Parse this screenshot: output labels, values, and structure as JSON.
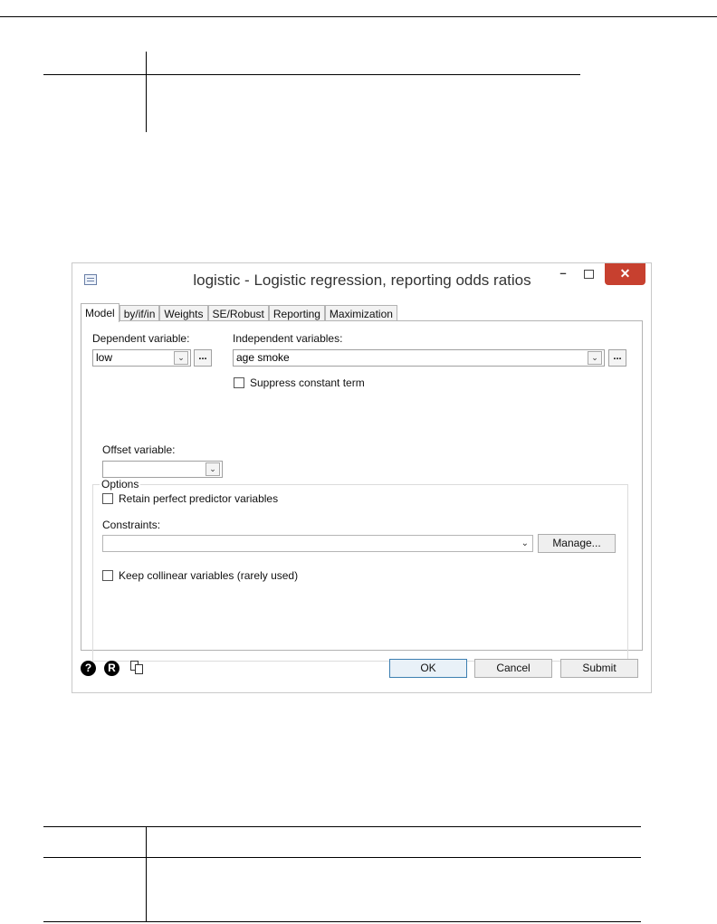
{
  "dialog": {
    "title": "logistic - Logistic regression, reporting odds ratios",
    "window_controls": {
      "minimize": "–",
      "close": "✕"
    },
    "tabs": [
      "Model",
      "by/if/in",
      "Weights",
      "SE/Robust",
      "Reporting",
      "Maximization"
    ],
    "active_tab": "Model",
    "model": {
      "dependent_label": "Dependent variable:",
      "dependent_value": "low",
      "independent_label": "Independent variables:",
      "independent_value": "age smoke",
      "suppress_constant_label": "Suppress constant term",
      "browse_label": "...",
      "options": {
        "group_title": "Options",
        "offset_label": "Offset variable:",
        "offset_value": "",
        "retain_label": "Retain perfect predictor variables",
        "constraints_label": "Constraints:",
        "constraints_value": "",
        "manage_label": "Manage...",
        "collinear_label": "Keep collinear variables (rarely used)"
      }
    },
    "footer": {
      "help_icon_glyph": "?",
      "reset_icon_glyph": "R",
      "ok_label": "OK",
      "cancel_label": "Cancel",
      "submit_label": "Submit"
    }
  }
}
